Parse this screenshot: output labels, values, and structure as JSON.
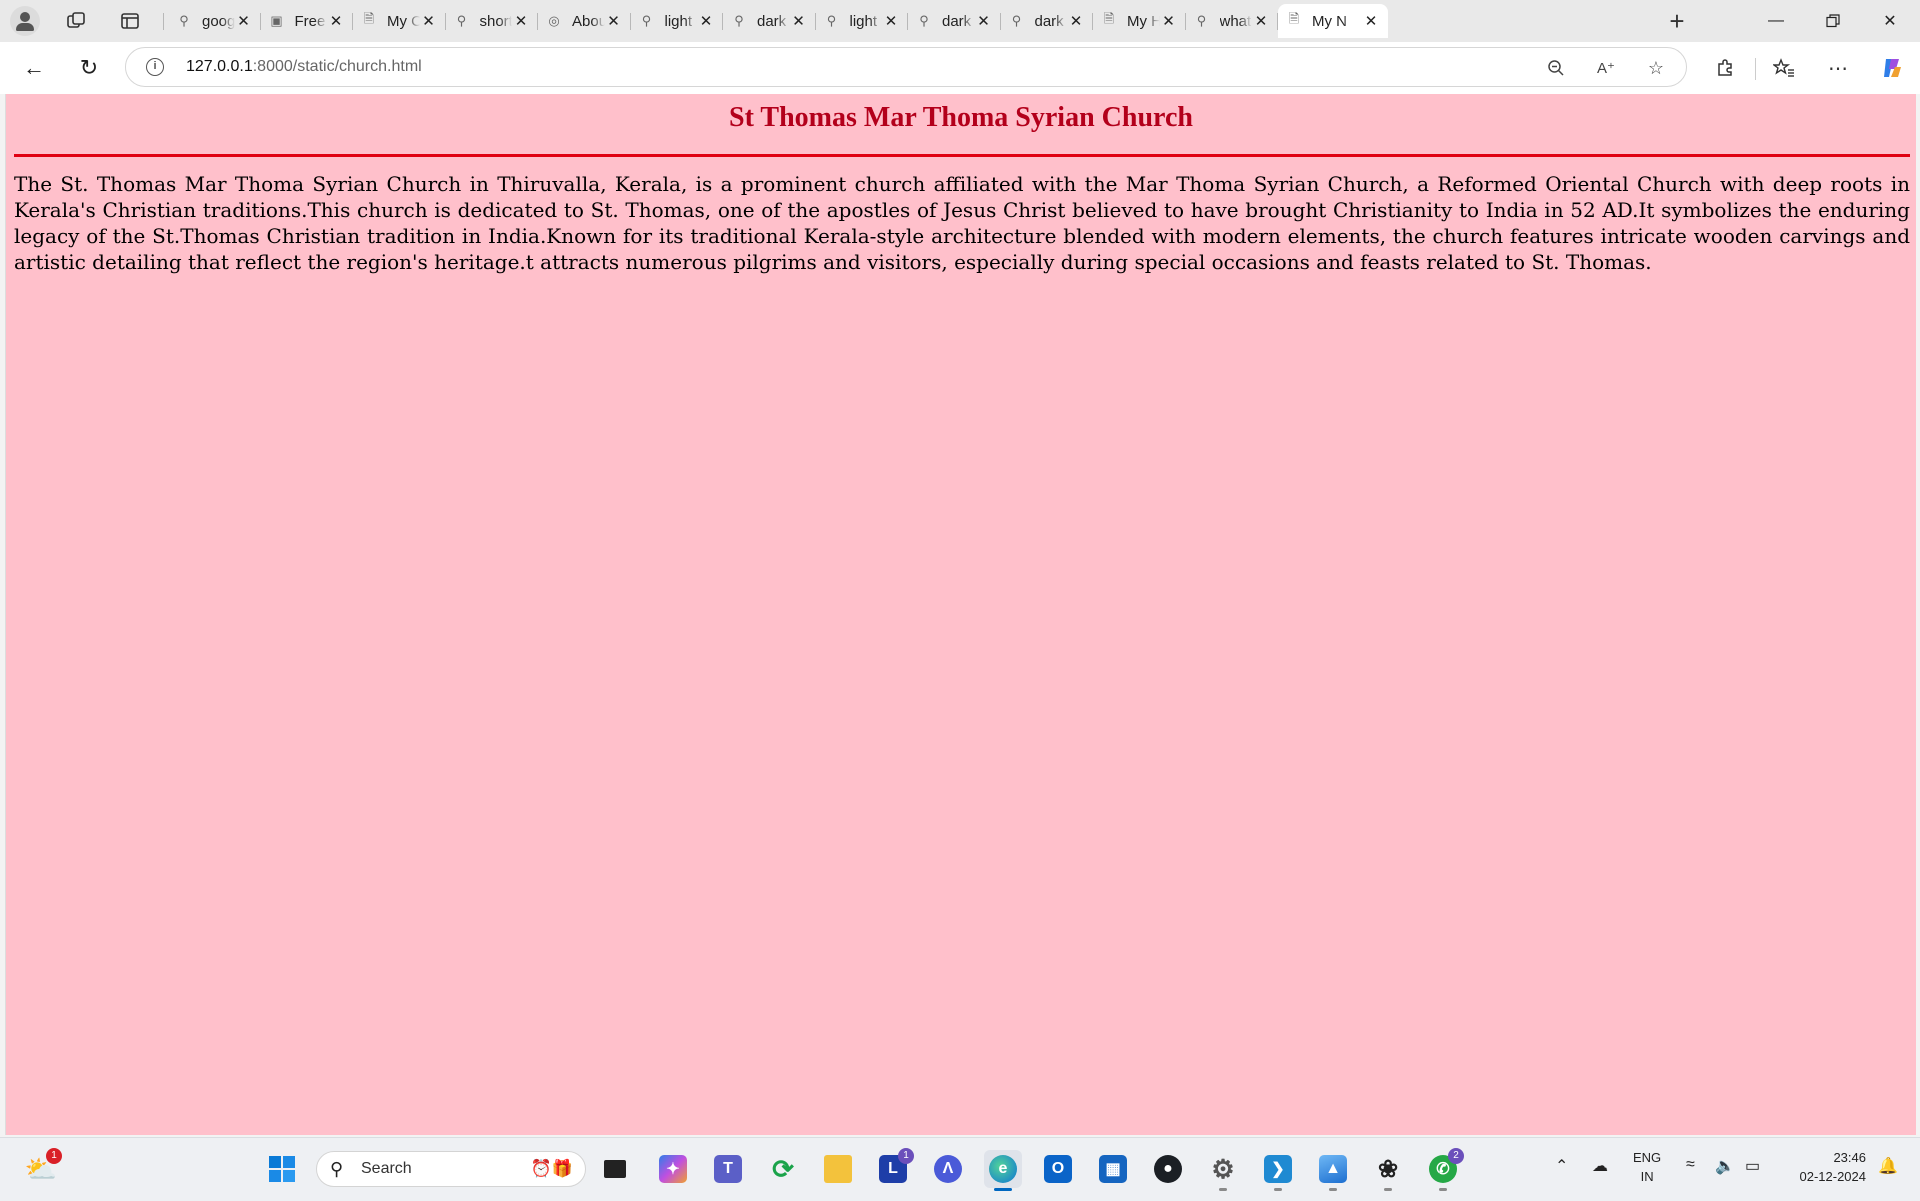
{
  "browser": {
    "tabs": [
      {
        "label": "google",
        "icon": "search-icon"
      },
      {
        "label": "Free C",
        "icon": "image-icon"
      },
      {
        "label": "My Ci",
        "icon": "page-icon"
      },
      {
        "label": "short",
        "icon": "search-icon"
      },
      {
        "label": "About",
        "icon": "site-icon"
      },
      {
        "label": "light c",
        "icon": "search-icon"
      },
      {
        "label": "dark b",
        "icon": "search-icon"
      },
      {
        "label": "light y",
        "icon": "search-icon"
      },
      {
        "label": "dark y",
        "icon": "search-icon"
      },
      {
        "label": "dark b",
        "icon": "search-icon"
      },
      {
        "label": "My H",
        "icon": "page-icon"
      },
      {
        "label": "what",
        "icon": "search-icon"
      },
      {
        "label": "My N",
        "icon": "page-icon",
        "active": true
      }
    ],
    "address": {
      "host": "127.0.0.1",
      "path": ":8000/static/church.html"
    }
  },
  "page": {
    "title": "St Thomas Mar Thoma Syrian Church",
    "paragraph": "The St. Thomas Mar Thoma Syrian Church in Thiruvalla, Kerala, is a prominent church affiliated with the Mar Thoma Syrian Church, a Reformed Oriental Church with deep roots in Kerala's Christian traditions.This church is dedicated to St. Thomas, one of the apostles of Jesus Christ believed to have brought Christianity to India in 52 AD.It symbolizes the enduring legacy of the St.Thomas Christian tradition in India.Known for its traditional Kerala-style architecture blended with modern elements, the church features intricate wooden carvings and artistic detailing that reflect the region's heritage.t attracts numerous pilgrims and visitors, especially during special occasions and feasts related to St. Thomas.",
    "background_color": "#ffc0cb",
    "title_color": "#b3001b",
    "rule_color": "#e00012"
  },
  "taskbar": {
    "search_label": "Search",
    "weather_badge": "1",
    "lens_badge": "1",
    "whatsapp_badge": "2",
    "lang_line1": "ENG",
    "lang_line2": "IN",
    "time": "23:46",
    "date": "02-12-2024"
  }
}
